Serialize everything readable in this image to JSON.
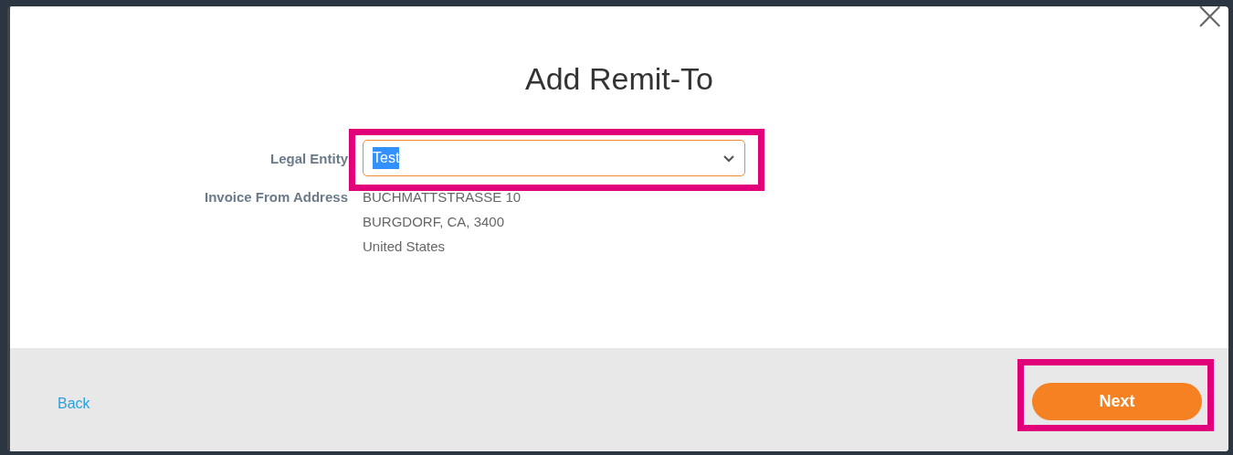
{
  "dialog": {
    "title": "Add Remit-To",
    "close_symbol": "×"
  },
  "form": {
    "legal_entity": {
      "label": "Legal Entity",
      "value": "Test",
      "value_selected": true,
      "focused": true
    },
    "invoice_from_address": {
      "label": "Invoice From Address",
      "lines": [
        "BUCHMATTSTRASSE 10",
        "BURGDORF, CA, 3400",
        "United States"
      ]
    }
  },
  "footer": {
    "back_link": "Back",
    "next_button": "Next"
  },
  "highlight_frames": {
    "legal_entity": true,
    "next_button": true
  }
}
